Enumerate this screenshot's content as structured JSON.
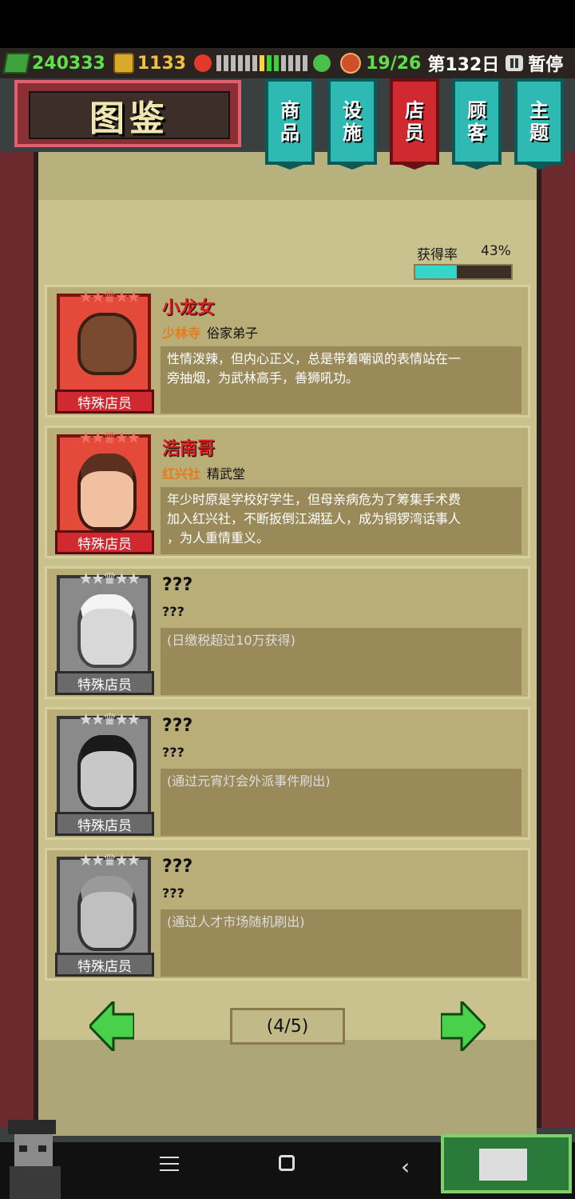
{
  "hud": {
    "cash": "240333",
    "coins": "1133",
    "staff": "19/26",
    "day": "第132日",
    "pause": "暂停",
    "mood_colors": [
      "#bbbbbb",
      "#bbbbbb",
      "#bbbbbb",
      "#bbbbbb",
      "#bbbbbb",
      "#bbbbbb",
      "#ffd23a",
      "#3ad23a",
      "#3ad23a",
      "#bbbbbb",
      "#bbbbbb",
      "#bbbbbb",
      "#bbbbbb"
    ]
  },
  "title": "图鉴",
  "tabs": [
    {
      "label_top": "商",
      "label_bottom": "品",
      "active": false
    },
    {
      "label_top": "设",
      "label_bottom": "施",
      "active": false
    },
    {
      "label_top": "店",
      "label_bottom": "员",
      "active": true
    },
    {
      "label_top": "顾",
      "label_bottom": "客",
      "active": false
    },
    {
      "label_top": "主",
      "label_bottom": "题",
      "active": false
    }
  ],
  "rate": {
    "label": "获得率",
    "value": "43%",
    "fraction": 0.43
  },
  "cards": [
    {
      "name": "小龙女",
      "org": "少林寺",
      "role": "俗家弟子",
      "desc_lines": [
        "性情泼辣，但内心正义，总是带着嘲讽的表情站在一",
        "旁抽烟，为武林高手，善狮吼功。",
        ""
      ],
      "badge": "特殊店员",
      "stars": "★★♛★★",
      "unlocked": true
    },
    {
      "name": "浩南哥",
      "org": "红兴社",
      "role": "精武堂",
      "desc_lines": [
        "年少时原是学校好学生，但母亲病危为了筹集手术费",
        "加入红兴社，不断扳倒江湖猛人，成为铜锣湾话事人",
        "，为人重情重义。"
      ],
      "badge": "特殊店员",
      "stars": "★★♛★★",
      "unlocked": true
    },
    {
      "name": "???",
      "org": "???",
      "role": "",
      "desc_lines": [
        "(日缴税超过10万获得)",
        "",
        ""
      ],
      "badge": "特殊店员",
      "stars": "★★♛★★",
      "unlocked": false
    },
    {
      "name": "???",
      "org": "???",
      "role": "",
      "desc_lines": [
        "(通过元宵灯会外派事件刷出)",
        "",
        ""
      ],
      "badge": "特殊店员",
      "stars": "★★♛★★",
      "unlocked": false
    },
    {
      "name": "???",
      "org": "???",
      "role": "",
      "desc_lines": [
        "(通过人才市场随机刷出)",
        "",
        ""
      ],
      "badge": "特殊店员",
      "stars": "★★♛★★",
      "unlocked": false
    }
  ],
  "pager": {
    "label": "(4/5)"
  },
  "icons": {
    "cash": "cash-icon",
    "coin": "coin-icon",
    "angry": "angry-face-icon",
    "happy": "happy-face-icon",
    "person": "staff-icon",
    "pause": "pause-icon",
    "prev": "arrow-left-icon",
    "next": "arrow-right-icon"
  }
}
